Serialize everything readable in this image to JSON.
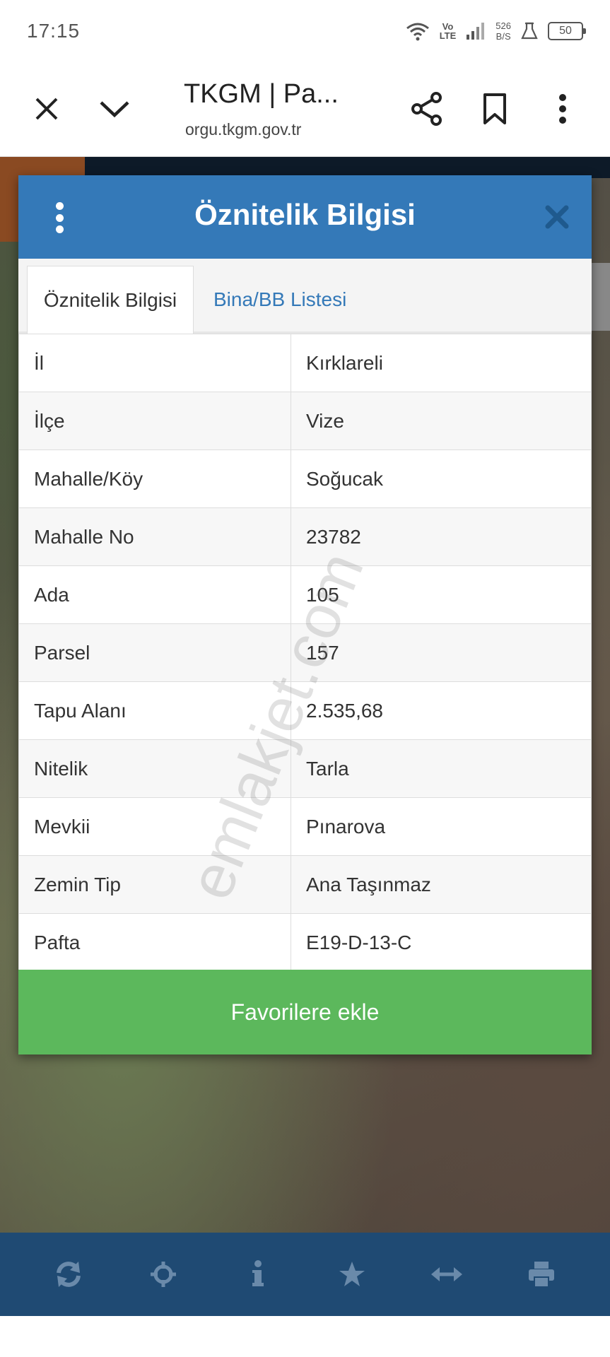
{
  "status_bar": {
    "time": "17:15",
    "vo_top": "Vo",
    "vo_bottom": "LTE",
    "speed_value": "526",
    "speed_unit": "B/S",
    "battery": "50",
    "icons": [
      "wifi-icon",
      "signal-icon",
      "lab-icon",
      "battery-icon"
    ]
  },
  "browser": {
    "title": "TKGM | Pa...",
    "url": "orgu.tkgm.gov.tr",
    "icons": [
      "close-icon",
      "chevron-down-icon",
      "share-icon",
      "bookmark-icon",
      "more-vert-icon"
    ]
  },
  "modal": {
    "title": "Öznitelik Bilgisi",
    "tabs": [
      {
        "label": "Öznitelik Bilgisi",
        "active": true
      },
      {
        "label": "Bina/BB Listesi",
        "active": false
      }
    ],
    "rows": [
      {
        "key": "İl",
        "value": "Kırklareli"
      },
      {
        "key": "İlçe",
        "value": "Vize"
      },
      {
        "key": "Mahalle/Köy",
        "value": "Soğucak"
      },
      {
        "key": "Mahalle No",
        "value": "23782"
      },
      {
        "key": "Ada",
        "value": "105"
      },
      {
        "key": "Parsel",
        "value": "157"
      },
      {
        "key": "Tapu Alanı",
        "value": "2.535,68"
      },
      {
        "key": "Nitelik",
        "value": "Tarla"
      },
      {
        "key": "Mevkii",
        "value": "Pınarova"
      },
      {
        "key": "Zemin Tip",
        "value": "Ana Taşınmaz"
      },
      {
        "key": "Pafta",
        "value": "E19-D-13-C"
      }
    ],
    "favorite_label": "Favorilere ekle"
  },
  "watermark": "emlakjet.com",
  "bottom_toolbar": [
    "refresh-icon",
    "crosshair-icon",
    "info-icon",
    "star-icon",
    "arrows-horizontal-icon",
    "print-icon"
  ],
  "colors": {
    "header_blue": "#3479b8",
    "button_green": "#5cb85c",
    "toolbar_navy": "#1f4a73"
  }
}
